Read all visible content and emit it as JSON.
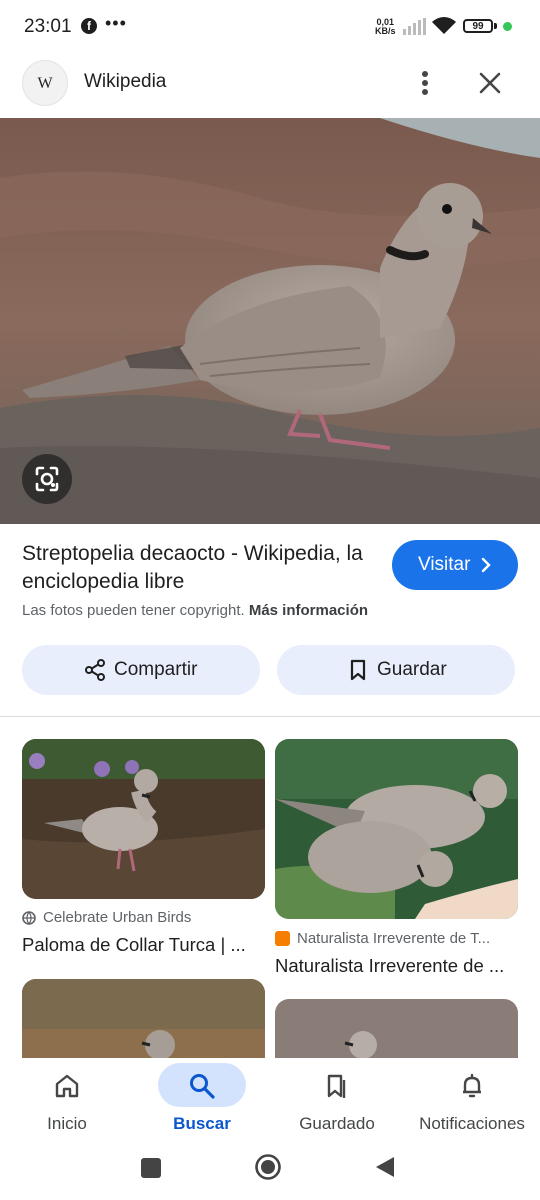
{
  "status_bar": {
    "time": "23:01",
    "net_speed_value": "0,01",
    "net_speed_unit": "KB/s",
    "battery": "99",
    "icons": [
      "facebook-icon",
      "more-dots-icon",
      "signal-icon",
      "wifi-icon",
      "battery-icon"
    ]
  },
  "header": {
    "logo_text": "W",
    "site_name": "Wikipedia",
    "icons": [
      "more-vert-icon",
      "close-icon"
    ]
  },
  "result": {
    "title": "Streptopelia decaocto - Wikipedia, la enciclopedia libre",
    "visit_label": "Visitar",
    "copyright_text": "Las fotos pueden tener copyright.",
    "more_info": "Más información",
    "share_label": "Compartir",
    "save_label": "Guardar"
  },
  "related": [
    {
      "source": "Celebrate Urban Birds",
      "title": "Paloma de Collar Turca | ...",
      "source_icon": "globe-icon"
    },
    {
      "source": "Naturalista Irreverente de T...",
      "title": "Naturalista Irreverente de ...",
      "source_icon": "blogger-icon"
    }
  ],
  "bottom_nav": {
    "items": [
      {
        "label": "Inicio",
        "icon": "home-icon"
      },
      {
        "label": "Buscar",
        "icon": "search-icon"
      },
      {
        "label": "Guardado",
        "icon": "bookmarks-icon"
      },
      {
        "label": "Notificaciones",
        "icon": "bell-icon"
      }
    ],
    "active": "Buscar"
  },
  "colors": {
    "accent": "#1a73e8",
    "chip_bg": "#e8eefb",
    "nav_active_pill": "#d3e3fd",
    "active_label": "#0b57d0"
  }
}
